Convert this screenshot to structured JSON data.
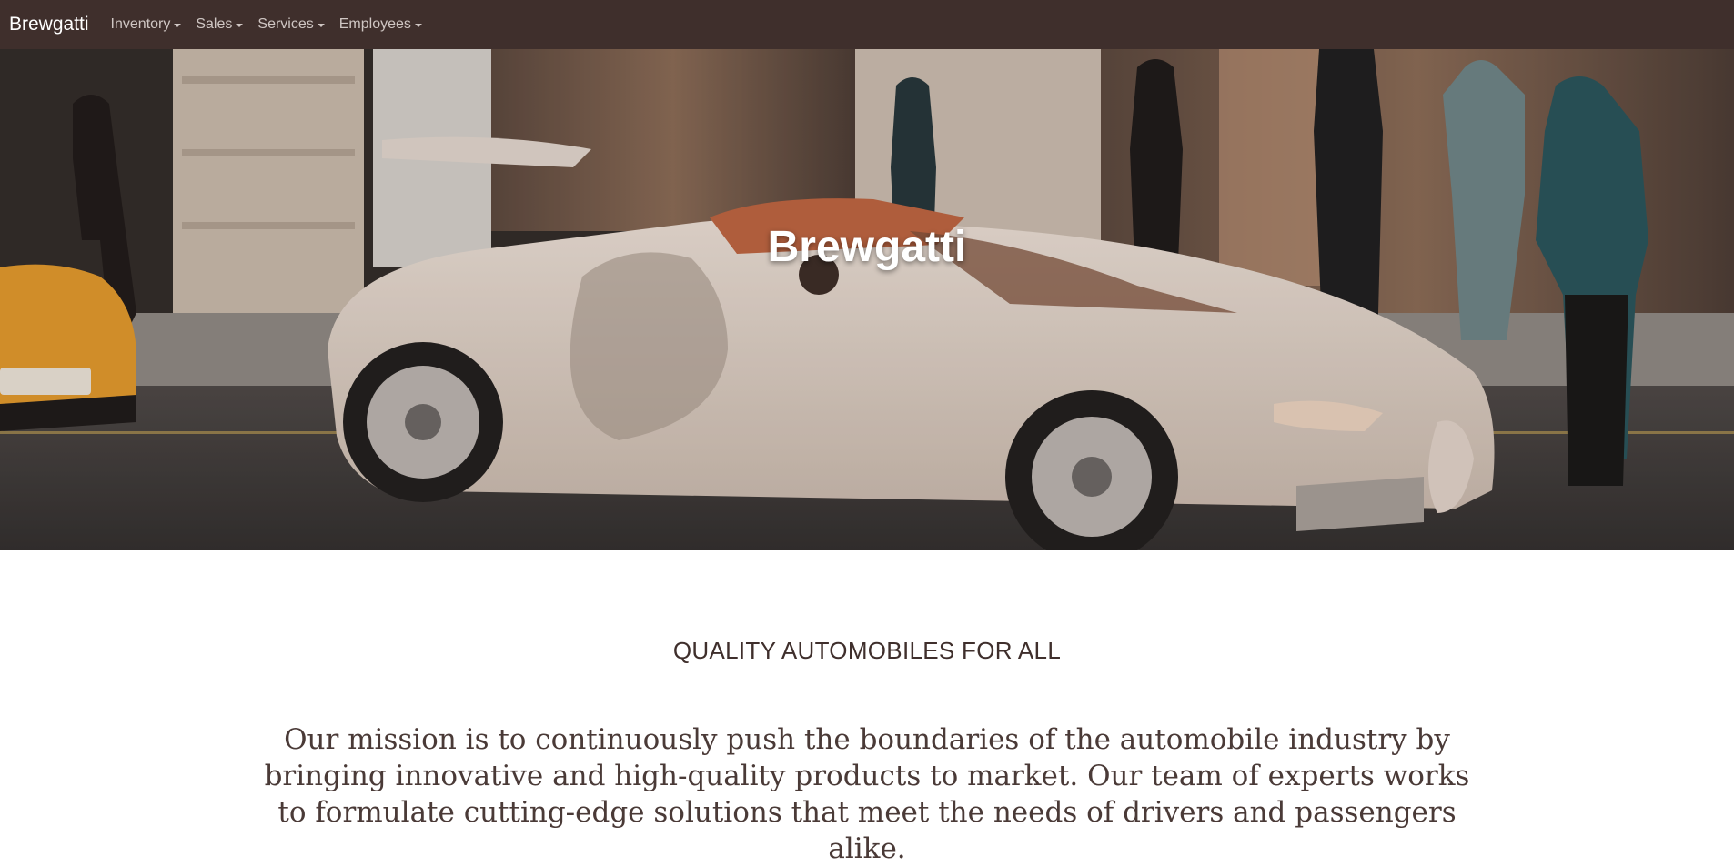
{
  "navbar": {
    "brand": "Brewgatti",
    "items": [
      {
        "label": "Inventory"
      },
      {
        "label": "Sales"
      },
      {
        "label": "Services"
      },
      {
        "label": "Employees"
      }
    ]
  },
  "hero": {
    "title": "Brewgatti"
  },
  "main": {
    "tagline": "QUALITY AUTOMOBILES FOR ALL",
    "mission": "Our mission is to continuously push the boundaries of the automobile industry by bringing innovative and high-quality products to market. Our team of experts works to formulate cutting-edge solutions that meet the needs of drivers and passengers alike."
  },
  "colors": {
    "navbar_bg": "#3f2f2c",
    "nav_text": "#cfc6c3",
    "text_dark": "#3f2f2c"
  }
}
